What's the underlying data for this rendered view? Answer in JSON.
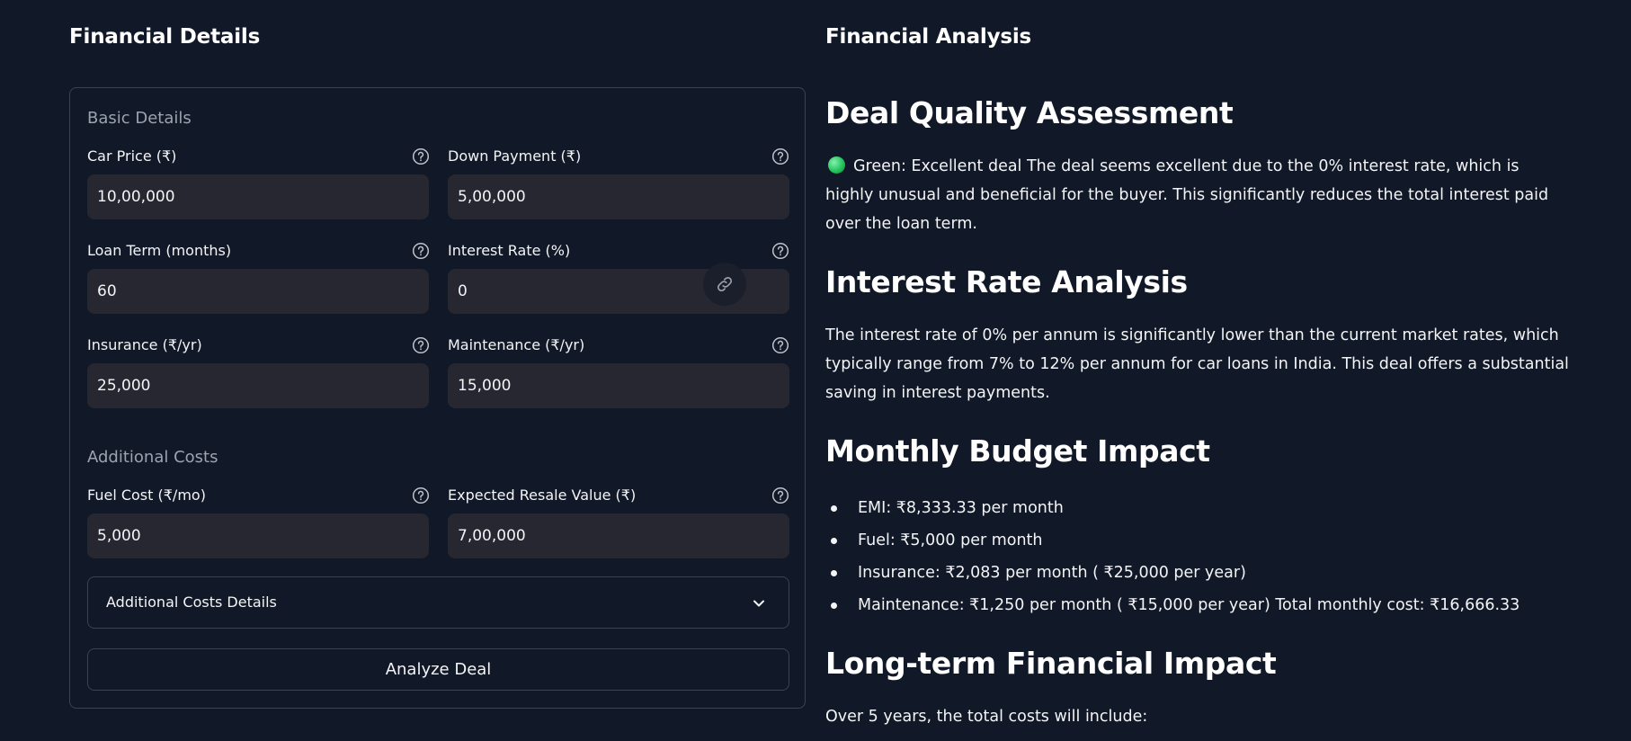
{
  "left": {
    "heading": "Financial Details",
    "basic_group_label": "Basic Details",
    "additional_group_label": "Additional Costs",
    "fields": {
      "car_price": {
        "label": "Car Price (₹)",
        "value": "10,00,000"
      },
      "down_payment": {
        "label": "Down Payment (₹)",
        "value": "5,00,000"
      },
      "loan_term": {
        "label": "Loan Term (months)",
        "value": "60"
      },
      "interest_rate": {
        "label": "Interest Rate (%)",
        "value": "0"
      },
      "insurance": {
        "label": "Insurance (₹/yr)",
        "value": "25,000"
      },
      "maintenance": {
        "label": "Maintenance (₹/yr)",
        "value": "15,000"
      },
      "fuel_cost": {
        "label": "Fuel Cost (₹/mo)",
        "value": "5,000"
      },
      "resale_value": {
        "label": "Expected Resale Value (₹)",
        "value": "7,00,000"
      }
    },
    "expander_label": "Additional Costs Details",
    "analyze_label": "Analyze Deal"
  },
  "right": {
    "heading": "Financial Analysis",
    "deal_quality": {
      "title": "Deal Quality Assessment",
      "text": "Green: Excellent deal The deal seems excellent due to the 0% interest rate, which is highly unusual and beneficial for the buyer. This significantly reduces the total interest paid over the loan term."
    },
    "interest": {
      "title": "Interest Rate Analysis",
      "text": "The interest rate of 0% per annum is significantly lower than the current market rates, which typically range from 7% to 12% per annum for car loans in India. This deal offers a substantial saving in interest payments."
    },
    "budget": {
      "title": "Monthly Budget Impact",
      "items": [
        "EMI: ₹8,333.33 per month",
        "Fuel: ₹5,000 per month",
        "Insurance: ₹2,083 per month ( ₹25,000 per year)",
        "Maintenance: ₹1,250 per month ( ₹15,000 per year) Total monthly cost: ₹16,666.33"
      ]
    },
    "longterm": {
      "title": "Long-term Financial Impact",
      "text": "Over 5 years, the total costs will include:"
    }
  },
  "colors": {
    "background": "#111827",
    "input_bg": "#262730",
    "border": "#3b4252",
    "status_green": "#22c55e"
  }
}
